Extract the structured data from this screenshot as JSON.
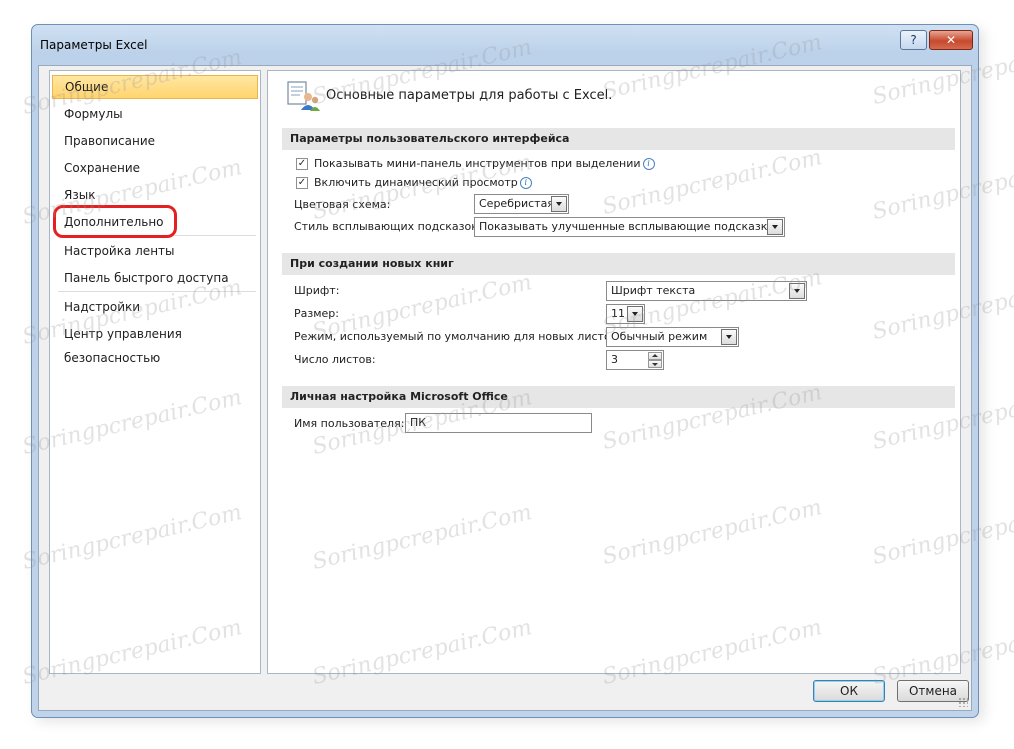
{
  "window": {
    "title": "Параметры Excel",
    "help_label": "?",
    "close_label": "✕"
  },
  "nav": {
    "items": [
      {
        "label": "Общие"
      },
      {
        "label": "Формулы"
      },
      {
        "label": "Правописание"
      },
      {
        "label": "Сохранение"
      },
      {
        "label": "Язык"
      },
      {
        "label": "Дополнительно"
      },
      {
        "label": "Настройка ленты"
      },
      {
        "label": "Панель быстрого доступа"
      },
      {
        "label": "Надстройки"
      },
      {
        "label": "Центр управления безопасностью"
      }
    ],
    "selected": "Общие",
    "highlighted": "Дополнительно"
  },
  "content": {
    "header_title": "Основные параметры для работы с Excel.",
    "ui_section": {
      "title": "Параметры пользовательского интерфейса",
      "mini_toolbar_label": "Показывать мини-панель инструментов при выделении",
      "mini_toolbar_checked": true,
      "live_preview_label": "Включить динамический просмотр",
      "live_preview_checked": true,
      "color_scheme_label": "Цветовая схема:",
      "color_scheme_value": "Серебристая",
      "tooltip_style_label": "Стиль всплывающих подсказок:",
      "tooltip_style_value": "Показывать улучшенные всплывающие подсказки"
    },
    "new_book_section": {
      "title": "При создании новых книг",
      "font_label": "Шрифт:",
      "font_value": "Шрифт текста",
      "size_label": "Размер:",
      "size_value": "11",
      "view_label": "Режим, используемый по умолчанию для новых листов:",
      "view_value": "Обычный режим",
      "sheets_label": "Число листов:",
      "sheets_value": "3"
    },
    "personal_section": {
      "title": "Личная настройка Microsoft Office",
      "username_label": "Имя пользователя:",
      "username_value": "ПК"
    }
  },
  "footer": {
    "ok_label": "ОК",
    "cancel_label": "Отмена"
  },
  "watermark": "Soringpcrepair.Com",
  "colors": {
    "selected_nav_bg": "#ffd46e",
    "highlight_ring": "#e52020",
    "section_header_bg": "#e6e6e6"
  }
}
